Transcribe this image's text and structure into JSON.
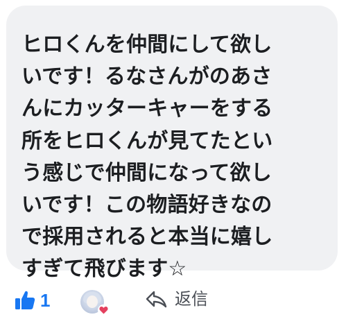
{
  "comment": {
    "lines": [
      "ヒロくんを仲間にして欲し",
      "いです！るなさんがのあさ",
      "んにカッターキャーをする",
      "所をヒロくんが見てたとい",
      "う感じで仲間になって欲し",
      "いです！この物語好きなの",
      "で採用されると本当に嬉し",
      "すぎて飛びます☆"
    ]
  },
  "actions": {
    "like_count": "1",
    "like_icon": "thumbs-up-icon",
    "reply_label": "返信",
    "reply_icon": "reply-arrow-icon",
    "reaction_icon": "heart-icon"
  },
  "colors": {
    "bubble_bg": "#f0f1f3",
    "text": "#1c1e21",
    "like_blue": "#1877f2",
    "heart_red": "#e4405f",
    "reply_gray": "#4b4f56"
  }
}
